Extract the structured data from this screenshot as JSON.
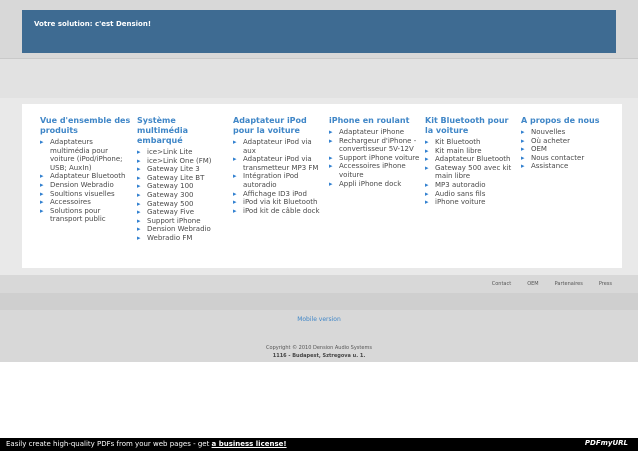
{
  "banner": {
    "text": "Votre solution: c'est Dension!"
  },
  "nav": {
    "columns": [
      {
        "title": "Vue d'ensemble des produits",
        "items": [
          "Adaptateurs multimédia pour voiture (iPod/iPhone; USB; AuxIn)",
          "Adaptateur Bluetooth",
          "Dension Webradio",
          "Soultions visuelles",
          "Accessoires",
          "Solutions pour transport public"
        ]
      },
      {
        "title": "Système multimédia embarqué",
        "items": [
          "ice>Link Lite",
          "ice>Link One (FM)",
          "Gateway Lite 3",
          "Gateway Lite BT",
          "Gateway 100",
          "Gateway 300",
          "Gateway 500",
          "Gateway Five",
          "Support iPhone",
          "Dension Webradio",
          "Webradio FM"
        ]
      },
      {
        "title": "Adaptateur iPod pour la voiture",
        "items": [
          "Adaptateur iPod via aux",
          "Adaptateur iPod via transmetteur MP3 FM",
          "Intégration iPod autoradio",
          "Affichage ID3 iPod",
          "iPod via kit Bluetooth",
          "iPod kit de câble dock"
        ]
      },
      {
        "title": "iPhone en roulant",
        "items": [
          "Adaptateur iPhone",
          "Rechargeur d'iPhone - convertisseur 5V-12V",
          "Support iPhone voiture",
          "Accessoires iPhone voiture",
          "Appli iPhone dock"
        ]
      },
      {
        "title": "Kit Bluetooth pour la voiture",
        "items": [
          "Kit Bluetooth",
          "Kit main libre",
          "Adaptateur Bluetooth",
          "Gateway 500 avec kit main libre",
          "MP3 autoradio",
          "Audio sans fils",
          "iPhone voiture"
        ]
      },
      {
        "title": "A propos de nous",
        "items": [
          "Nouvelles",
          "Où acheter",
          "OEM",
          "Nous contacter",
          "Assistance"
        ]
      }
    ]
  },
  "footer": {
    "links": [
      "Contact",
      "OEM",
      "Partenaires",
      "Press"
    ],
    "mobile": "Mobile version",
    "copyright": "Copyright © 2010 Dension Audio Systems",
    "address": "1116 - Budapest, Sztregova u. 1."
  },
  "pdf_bar": {
    "text": "Easily create high-quality PDFs from your web pages - get ",
    "link": "a business license!",
    "logo": "PDFmyURL"
  }
}
